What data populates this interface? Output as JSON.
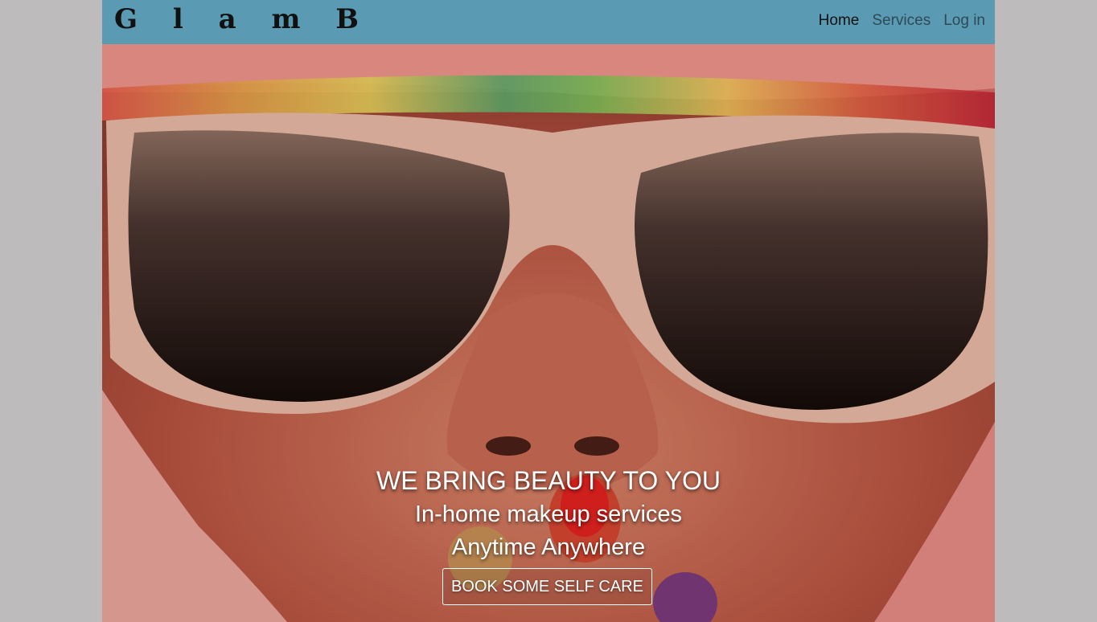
{
  "brand": {
    "name": "G l a m B"
  },
  "nav": {
    "items": [
      {
        "label": "Home",
        "active": true
      },
      {
        "label": "Services",
        "active": false
      },
      {
        "label": "Log in",
        "active": false
      }
    ]
  },
  "hero": {
    "image": "woman-in-white-sunglasses-photo",
    "headline": "WE BRING BEAUTY TO YOU",
    "subline1": "In-home makeup services",
    "subline2": "Anytime Anywhere",
    "cta_label": "BOOK SOME SELF CARE"
  },
  "colors": {
    "navbar_bg": "#5b9ab3",
    "page_bg": "#bdbbbc",
    "nav_link": "#2c4a57",
    "nav_active": "#111111"
  }
}
